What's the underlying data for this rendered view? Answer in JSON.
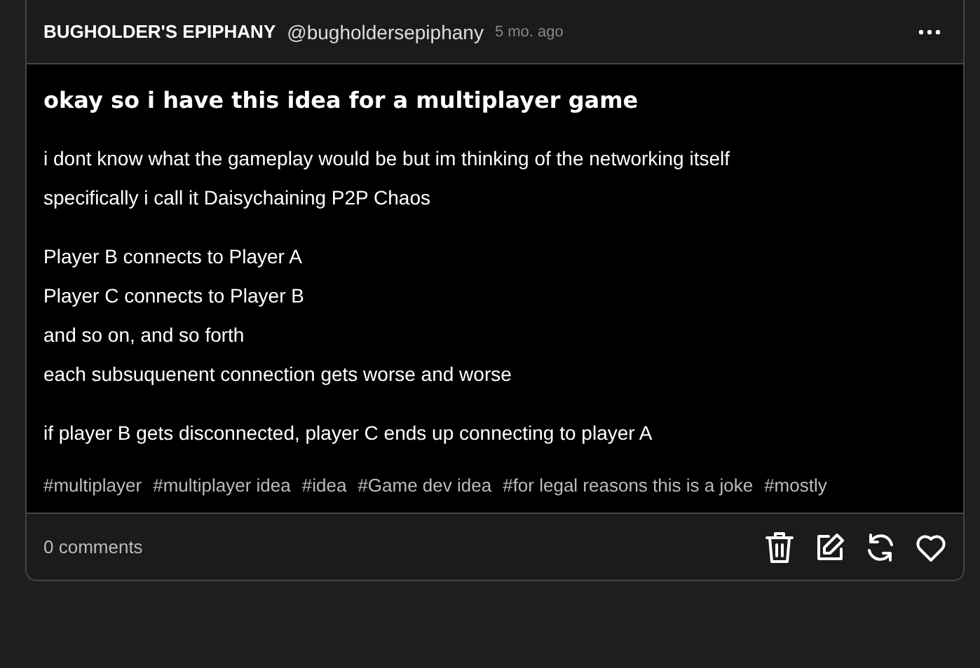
{
  "post": {
    "author": "BUGHOLDER'S EPIPHANY",
    "handle": "@bugholdersepiphany",
    "time": "5 mo. ago",
    "title": "okay so i have this idea for a multiplayer game",
    "paragraphs": [
      [
        "i dont know what the gameplay would be but im thinking of the networking itself",
        "specifically i call it Daisychaining P2P Chaos"
      ],
      [
        "Player B connects to Player A",
        "Player C connects to Player B",
        "and so on, and so forth",
        "each subsuquenent connection gets worse and worse"
      ],
      [
        "if player B gets disconnected, player C ends up connecting to player A"
      ]
    ],
    "tags": [
      "#multiplayer",
      "#multiplayer idea",
      "#idea",
      "#Game dev idea",
      "#for legal reasons this is a joke",
      "#mostly"
    ],
    "comments": "0 comments"
  }
}
